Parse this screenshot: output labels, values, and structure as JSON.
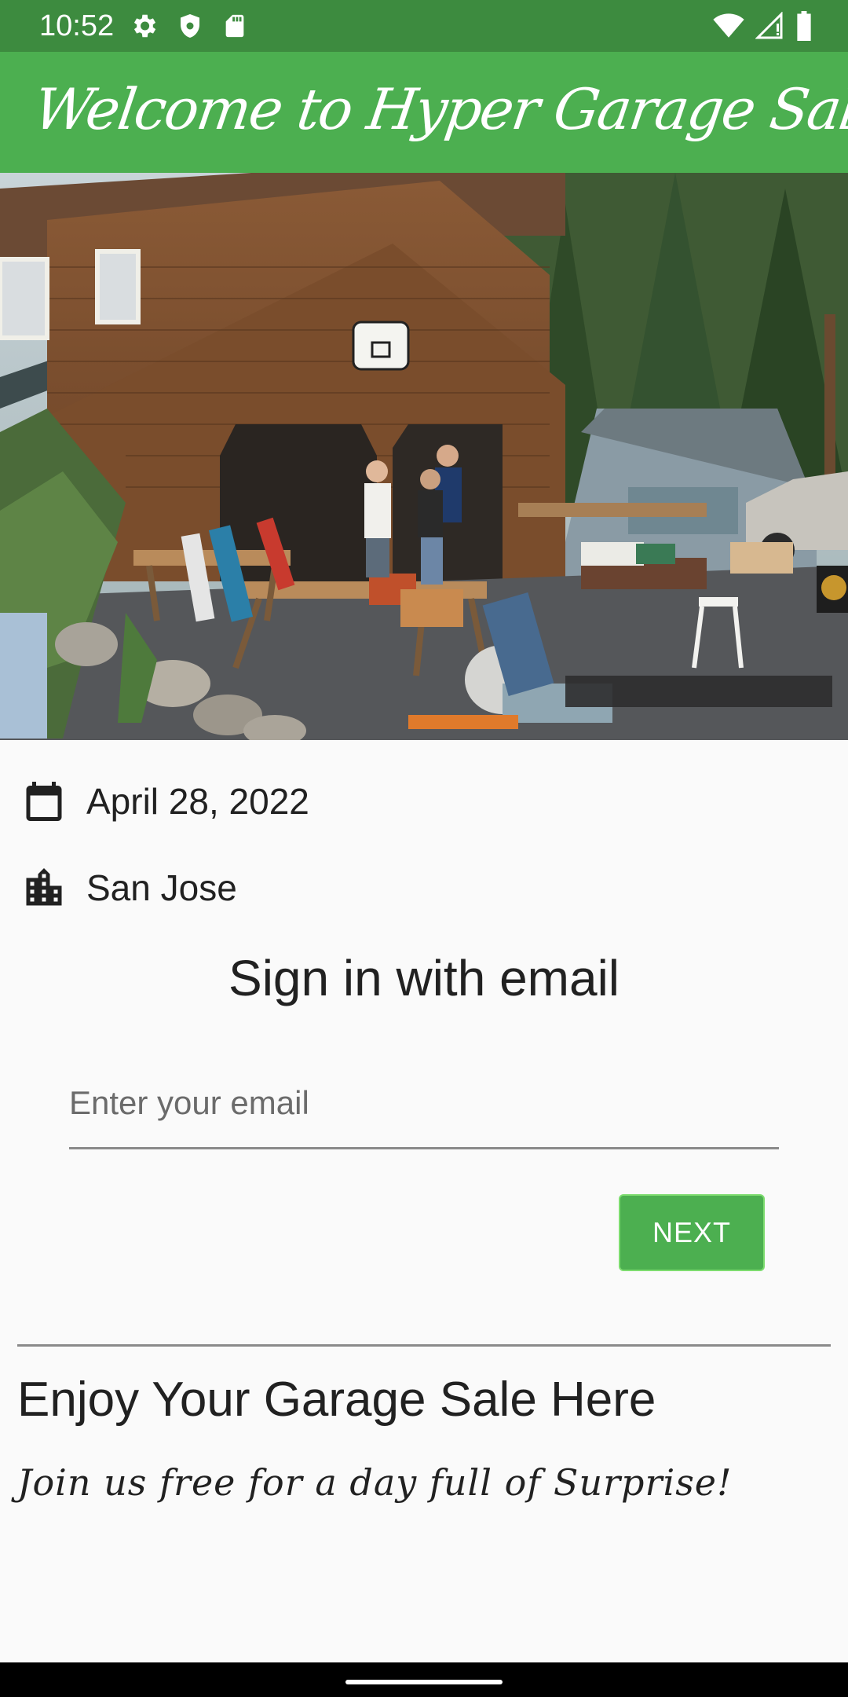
{
  "status_bar": {
    "time": "10:52",
    "left_icons": [
      "settings-icon",
      "shield-icon",
      "sd-card-icon"
    ],
    "right_icons": [
      "wifi-icon",
      "cellular-signal-icon",
      "battery-icon"
    ]
  },
  "app_bar": {
    "title": "Welcome to Hyper Garage Sale",
    "background": "#4caf50"
  },
  "event": {
    "date": "April 28, 2022",
    "city": "San Jose",
    "date_icon": "calendar-icon",
    "city_icon": "city-icon"
  },
  "signin": {
    "title": "Sign in with email",
    "email_placeholder": "Enter your email",
    "email_value": "",
    "next_label": "NEXT"
  },
  "promo": {
    "title": "Enjoy Your Garage Sale Here",
    "subtitle": "Join us free for a day full of Surprise!"
  },
  "colors": {
    "status_bar": "#3d8b3f",
    "accent": "#4caf50",
    "text": "#212121"
  }
}
